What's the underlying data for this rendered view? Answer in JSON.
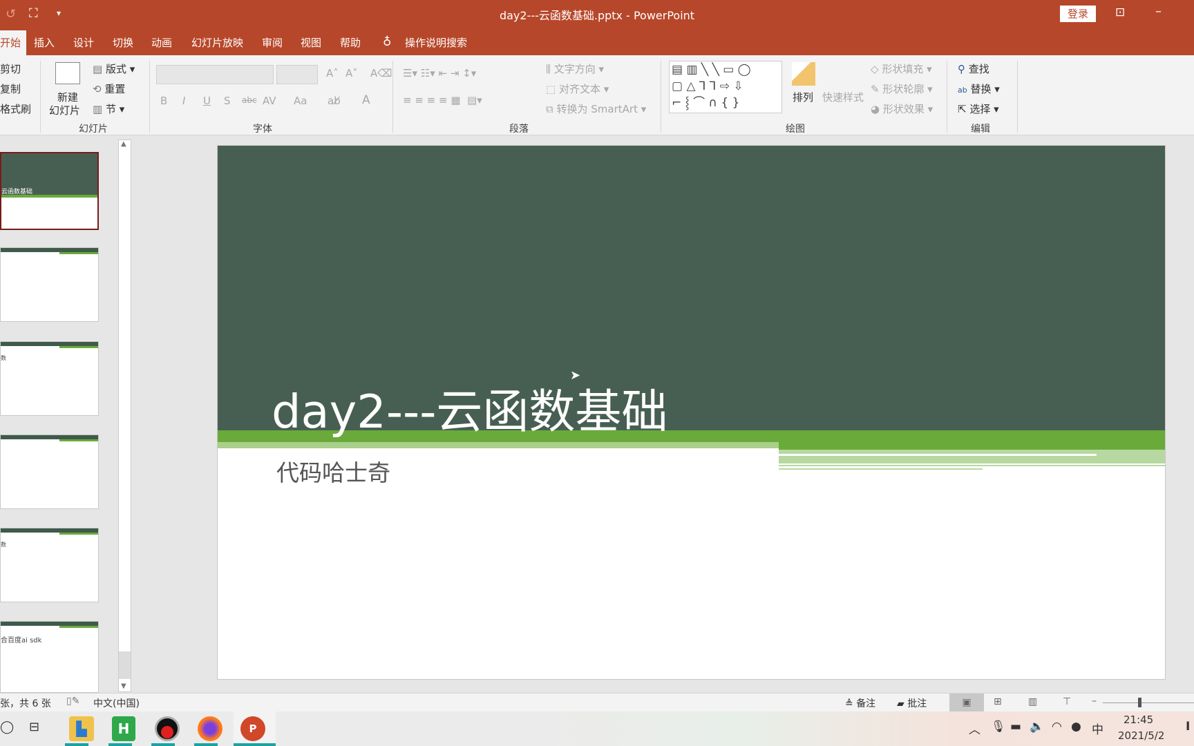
{
  "window": {
    "title": "day2---云函数基础.pptx  -  PowerPoint",
    "login_label": "登录",
    "accent": "#b7472a"
  },
  "tabs": [
    "开始",
    "插入",
    "设计",
    "切换",
    "动画",
    "幻灯片放映",
    "审阅",
    "视图",
    "帮助"
  ],
  "tell_me": "操作说明搜索",
  "ribbon": {
    "clipboard": {
      "cut": "剪切",
      "copy": "复制",
      "format_painter": "格式刷"
    },
    "slides": {
      "new_slide_line1": "新建",
      "new_slide_line2": "幻灯片",
      "layout": "版式",
      "reset": "重置",
      "section": "节",
      "label": "幻灯片"
    },
    "font": {
      "bold": "B",
      "italic": "I",
      "underline": "U",
      "shadow": "S",
      "strike": "abc",
      "spacing": "AV",
      "case": "Aa",
      "color": "A",
      "label": "字体"
    },
    "paragraph": {
      "text_direction": "文字方向",
      "align_text": "对齐文本",
      "smartart": "转换为 SmartArt",
      "label": "段落"
    },
    "drawing": {
      "arrange": "排列",
      "quick_styles": "快速样式",
      "shape_fill": "形状填充",
      "shape_outline": "形状轮廓",
      "shape_effects": "形状效果",
      "label": "绘图"
    },
    "editing": {
      "find": "查找",
      "replace": "替换",
      "select": "选择",
      "label": "编辑"
    }
  },
  "thumbnails": [
    {
      "text": "云函数基础"
    },
    {
      "text": ""
    },
    {
      "text": "数"
    },
    {
      "text": ""
    },
    {
      "text": "数"
    },
    {
      "text": "合百度ai sdk"
    }
  ],
  "slide": {
    "title": "day2---云函数基础",
    "subtitle": "代码哈士奇",
    "dark_color": "#475f52",
    "green_color": "#6aaa3a"
  },
  "status": {
    "slide_count": "张，共 6 张",
    "language": "中文(中国)",
    "notes": "备注",
    "comments": "批注"
  },
  "taskbar": {
    "time": "21:45",
    "date": "2021/5/2",
    "ime": "中"
  }
}
